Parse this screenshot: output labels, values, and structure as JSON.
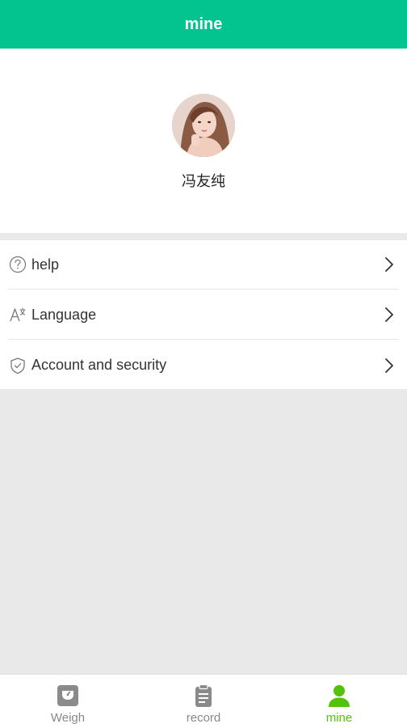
{
  "header": {
    "title": "mine"
  },
  "profile": {
    "username": "冯友纯"
  },
  "menu": {
    "items": [
      {
        "label": "help",
        "icon": "help-icon"
      },
      {
        "label": "Language",
        "icon": "language-icon"
      },
      {
        "label": "Account and security",
        "icon": "shield-icon"
      }
    ]
  },
  "tabbar": {
    "items": [
      {
        "label": "Weigh",
        "icon": "scale-icon",
        "active": false
      },
      {
        "label": "record",
        "icon": "clipboard-icon",
        "active": false
      },
      {
        "label": "mine",
        "icon": "user-icon",
        "active": true
      }
    ],
    "active_color": "#53c20b",
    "inactive_color": "#888888"
  },
  "colors": {
    "header_bg": "#03c48e",
    "page_bg": "#e9e9e9"
  }
}
